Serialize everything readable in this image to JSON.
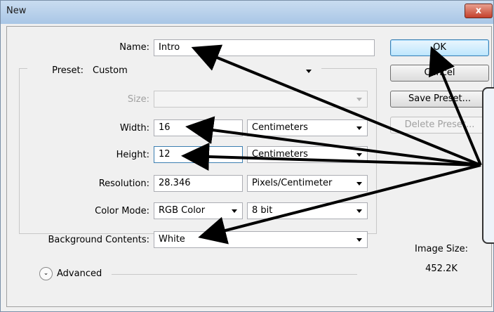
{
  "window": {
    "title": "New",
    "close_label": "x"
  },
  "form": {
    "name": {
      "label": "Name:",
      "value": "Intro"
    },
    "preset": {
      "label": "Preset:",
      "value": "Custom"
    },
    "size": {
      "label": "Size:",
      "value": ""
    },
    "width": {
      "label": "Width:",
      "value": "16",
      "unit": "Centimeters"
    },
    "height": {
      "label": "Height:",
      "value": "12",
      "unit": "Centimeters"
    },
    "resolution": {
      "label": "Resolution:",
      "value": "28.346",
      "unit": "Pixels/Centimeter"
    },
    "color_mode": {
      "label": "Color Mode:",
      "value": "RGB Color",
      "depth": "8 bit"
    },
    "background": {
      "label": "Background Contents:",
      "value": "White"
    },
    "advanced_label": "Advanced"
  },
  "buttons": {
    "ok": "OK",
    "cancel": "Cancel",
    "save_preset": "Save Preset...",
    "delete_preset": "Delete Preset..."
  },
  "image_size": {
    "label": "Image Size:",
    "value": "452.2K"
  },
  "icons": {
    "expand": "chevron-expand-icon",
    "close": "close-icon"
  }
}
